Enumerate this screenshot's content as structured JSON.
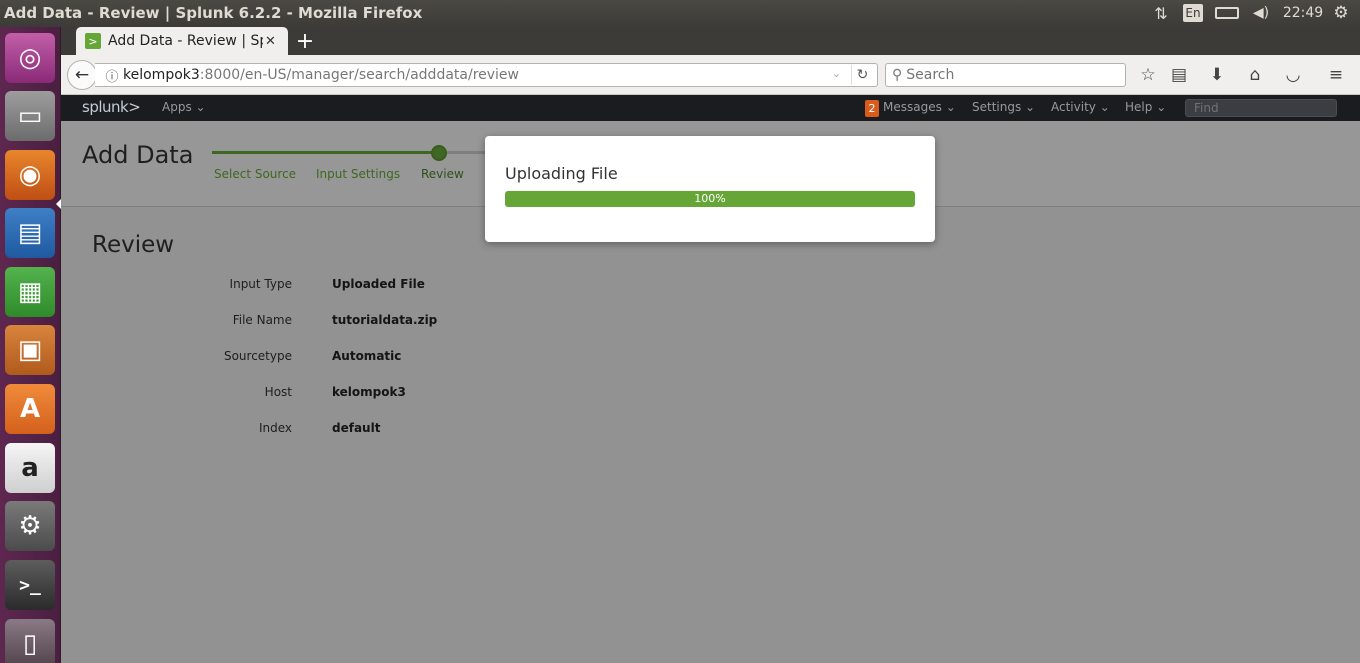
{
  "os": {
    "window_title": "Add Data - Review | Splunk 6.2.2 - Mozilla Firefox",
    "keyboard_layout": "En",
    "clock": "22:49",
    "tray_icons": [
      "network-icon",
      "keyboard-layout-icon",
      "battery-icon",
      "volume-icon",
      "session-gear-icon"
    ],
    "launcher": [
      {
        "name": "ubuntu-dash-icon",
        "glyph": "◎"
      },
      {
        "name": "files-icon",
        "glyph": "▭"
      },
      {
        "name": "firefox-icon",
        "glyph": "◉"
      },
      {
        "name": "libreoffice-writer-icon",
        "glyph": "▤"
      },
      {
        "name": "libreoffice-calc-icon",
        "glyph": "▦"
      },
      {
        "name": "libreoffice-impress-icon",
        "glyph": "▣"
      },
      {
        "name": "software-center-icon",
        "glyph": "A"
      },
      {
        "name": "amazon-icon",
        "glyph": "a"
      },
      {
        "name": "system-settings-icon",
        "glyph": "⚙"
      },
      {
        "name": "terminal-icon",
        "glyph": ">_"
      },
      {
        "name": "trash-icon",
        "glyph": "▯"
      }
    ]
  },
  "browser": {
    "tab_title": "Add Data - Review | Splunk",
    "tab_favicon": ">",
    "url_host": "kelompok3",
    "url_rest": ":8000/en-US/manager/search/adddata/review",
    "search_placeholder": "Search",
    "toolbar_icons": [
      "bookmark-star-icon",
      "reading-list-icon",
      "downloads-icon",
      "home-icon",
      "pocket-icon",
      "menu-icon"
    ]
  },
  "splunk_bar": {
    "logo": "splunk>",
    "apps_label": "Apps",
    "messages_count": "2",
    "messages_label": "Messages",
    "settings_label": "Settings",
    "activity_label": "Activity",
    "help_label": "Help",
    "find_placeholder": "Find"
  },
  "page": {
    "title": "Add Data",
    "steps": [
      "Select Source",
      "Input Settings",
      "Review"
    ],
    "current_step": "Review",
    "review_title": "Review",
    "rows": [
      {
        "label": "Input Type",
        "value": "Uploaded File"
      },
      {
        "label": "File Name",
        "value": "tutorialdata.zip"
      },
      {
        "label": "Sourcetype",
        "value": "Automatic"
      },
      {
        "label": "Host",
        "value": "kelompok3"
      },
      {
        "label": "Index",
        "value": "default"
      }
    ]
  },
  "modal": {
    "title": "Uploading File",
    "progress_percent": 100,
    "progress_text": "100%",
    "accent": "#65a637"
  }
}
